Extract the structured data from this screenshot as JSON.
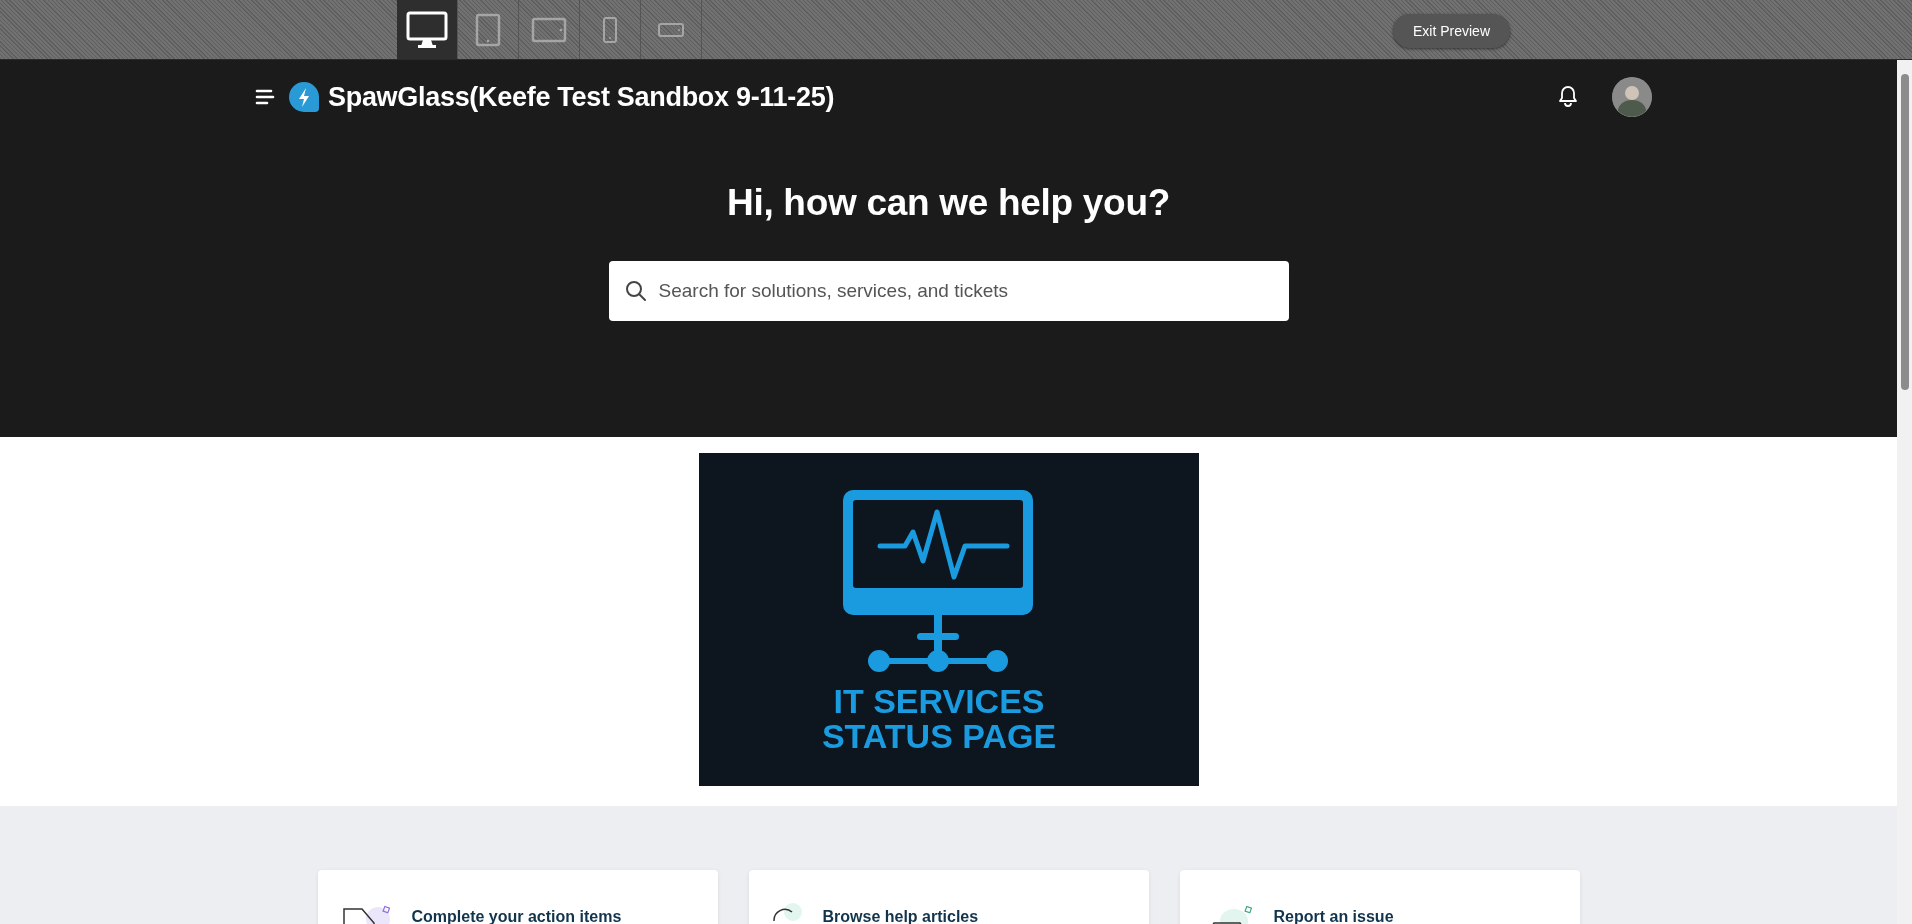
{
  "preview_bar": {
    "devices": [
      {
        "kind": "desktop",
        "selected": true
      },
      {
        "kind": "tablet",
        "selected": false
      },
      {
        "kind": "tablet-landscape",
        "selected": false
      },
      {
        "kind": "phone",
        "selected": false
      },
      {
        "kind": "phone-landscape",
        "selected": false
      }
    ],
    "exit_button": "Exit Preview"
  },
  "header": {
    "title": "SpawGlass(Keefe Test Sandbox 9-11-25)",
    "heading": "Hi, how can we help you?",
    "search": {
      "placeholder": "Search for solutions, services, and tickets"
    }
  },
  "banner": {
    "lines": [
      "IT SERVICES",
      "STATUS PAGE"
    ]
  },
  "cards": [
    {
      "kind": "tasks",
      "title": "Complete your action items"
    },
    {
      "kind": "articles",
      "title": "Browse help articles"
    },
    {
      "kind": "issue",
      "title": "Report an issue"
    }
  ]
}
